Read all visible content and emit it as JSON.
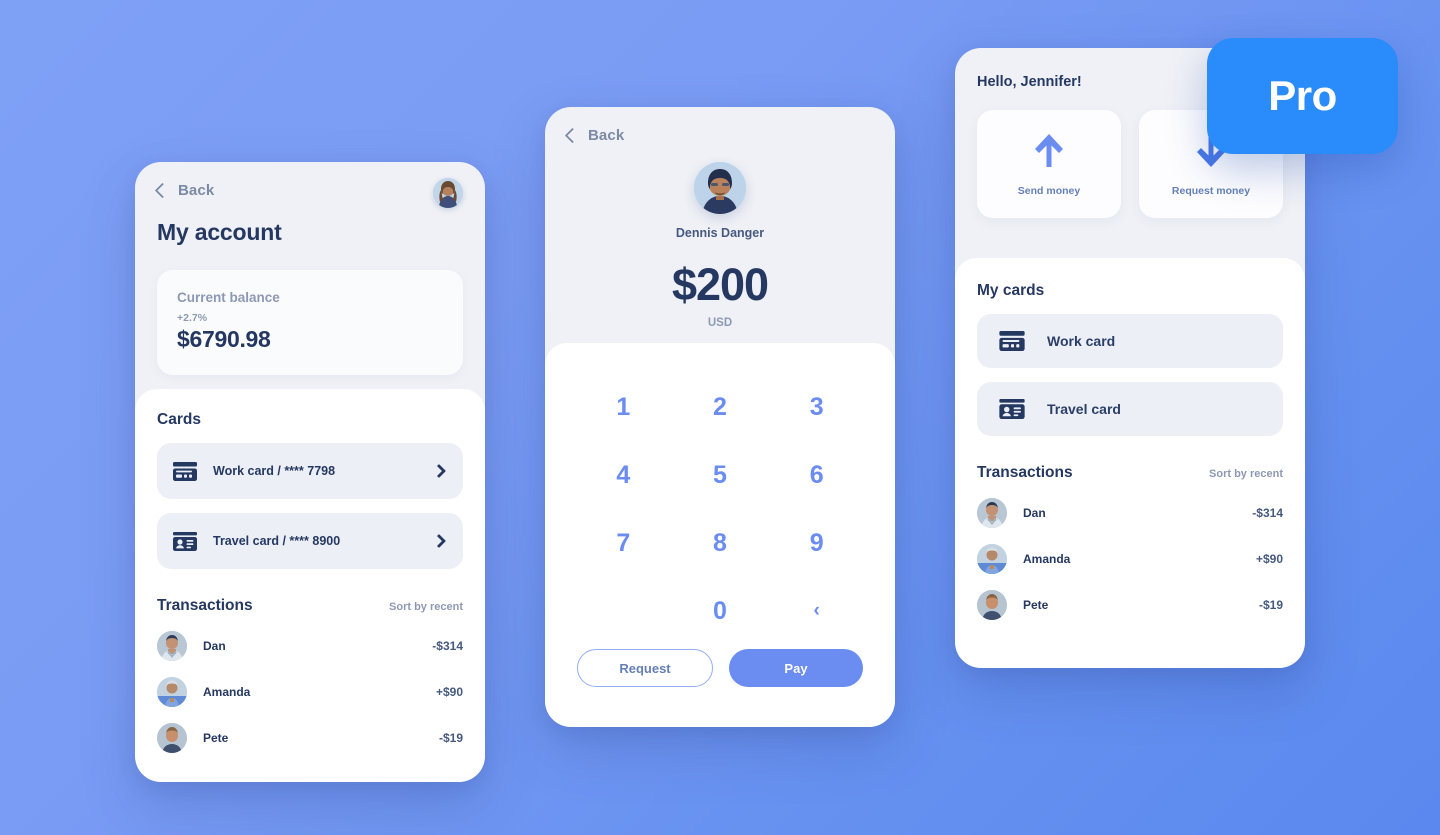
{
  "theme": {
    "bg_gradient_from": "#7ea0f5",
    "bg_gradient_to": "#5a88ee",
    "accent_blue": "#6b8cf0",
    "badge_blue": "#2a8bfa",
    "ink_dark": "#253861",
    "ink_muted": "#8d99b4",
    "surface_gray": "#eff1f6",
    "surface_white": "#ffffff",
    "row_gray": "#eceff5"
  },
  "pro_badge": {
    "label": "Pro"
  },
  "account_screen": {
    "back_label": "Back",
    "title": "My account",
    "avatar_alt": "user-avatar",
    "balance": {
      "label": "Current balance",
      "delta": "+2.7%",
      "amount": "$6790.98"
    },
    "cards_section": {
      "title": "Cards",
      "items": [
        {
          "icon": "credit-card-icon",
          "label": "Work card / **** 7798"
        },
        {
          "icon": "id-card-icon",
          "label": "Travel card / **** 8900"
        }
      ]
    },
    "transactions_section": {
      "title": "Transactions",
      "sort_label": "Sort by recent",
      "items": [
        {
          "name": "Dan",
          "amount": "-$314"
        },
        {
          "name": "Amanda",
          "amount": "+$90"
        },
        {
          "name": "Pete",
          "amount": "-$19"
        }
      ]
    }
  },
  "pay_screen": {
    "back_label": "Back",
    "payee_name": "Dennis Danger",
    "amount": "$200",
    "currency": "USD",
    "keypad": [
      "1",
      "2",
      "3",
      "4",
      "5",
      "6",
      "7",
      "8",
      "9",
      "",
      "0",
      "‹"
    ],
    "actions": {
      "request_label": "Request",
      "pay_label": "Pay"
    }
  },
  "home_screen": {
    "greeting": "Hello, Jennifer!",
    "quick_actions": [
      {
        "icon": "arrow-up-icon",
        "label": "Send money"
      },
      {
        "icon": "arrow-down-icon",
        "label": "Request money"
      }
    ],
    "cards_section": {
      "title": "My cards",
      "items": [
        {
          "icon": "credit-card-icon",
          "label": "Work card"
        },
        {
          "icon": "id-card-icon",
          "label": "Travel card"
        }
      ]
    },
    "transactions_section": {
      "title": "Transactions",
      "sort_label": "Sort by recent",
      "items": [
        {
          "name": "Dan",
          "amount": "-$314"
        },
        {
          "name": "Amanda",
          "amount": "+$90"
        },
        {
          "name": "Pete",
          "amount": "-$19"
        }
      ]
    }
  }
}
